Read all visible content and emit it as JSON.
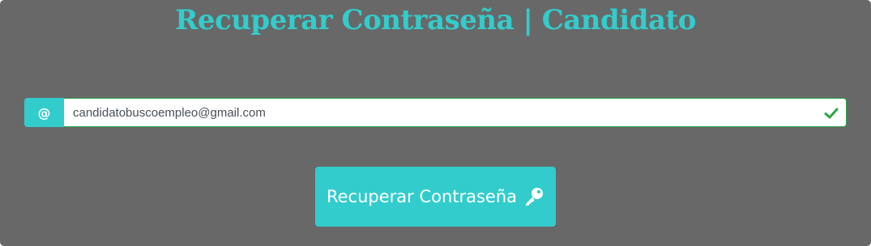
{
  "header": {
    "title": "Recuperar Contraseña | Candidato"
  },
  "form": {
    "addon_symbol": "@",
    "email_value": "candidatobuscoempleo@gmail.com",
    "email_valid": true,
    "submit_label": "Recuperar Contraseña",
    "submit_icon": "key-icon",
    "valid_icon": "check-icon"
  },
  "colors": {
    "background": "#686868",
    "accent": "#33cccc",
    "valid": "#28a745",
    "text_on_accent": "#ffffff"
  }
}
